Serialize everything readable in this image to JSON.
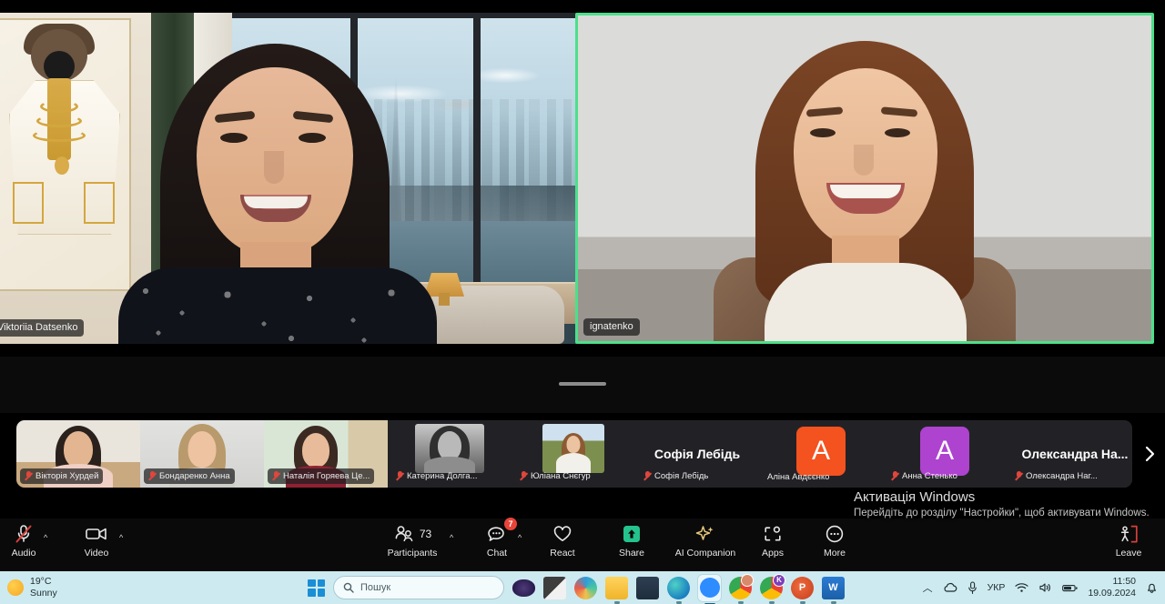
{
  "meeting": {
    "speakers": [
      {
        "name": "Viktoriia Datsenko",
        "active": false
      },
      {
        "name": "ignatenko",
        "active": true
      }
    ],
    "active_border_color": "#4ce08a"
  },
  "filmstrip": {
    "next_icon": "chevron-right-icon",
    "thumbs": [
      {
        "name": "Вікторія Хурдей",
        "kind": "video",
        "muted": true
      },
      {
        "name": "Бондаренко Анна",
        "kind": "video",
        "muted": true
      },
      {
        "name": "Наталія Горяева Це...",
        "kind": "video",
        "muted": true
      },
      {
        "name": "Катерина Долга...",
        "kind": "photo",
        "muted": true
      },
      {
        "name": "Юліана Снєгур",
        "kind": "photo",
        "muted": true
      },
      {
        "name": "Софія Лебідь",
        "kind": "name",
        "display": "Софія Лебідь",
        "muted": true
      },
      {
        "name": "Аліна Авдєєнко",
        "kind": "avatar",
        "letter": "A",
        "color": "#f4521f",
        "muted": false
      },
      {
        "name": "Анна Стенько",
        "kind": "avatar",
        "letter": "A",
        "color": "#ad43cf",
        "muted": true
      },
      {
        "name": "Олександра Наг...",
        "kind": "name",
        "display": "Олександра  На...",
        "muted": true
      }
    ]
  },
  "toolbar": {
    "audio": {
      "label": "Audio",
      "icon": "microphone-muted-icon",
      "muted": true
    },
    "video": {
      "label": "Video",
      "icon": "camera-icon"
    },
    "participants": {
      "label": "Participants",
      "icon": "people-icon",
      "count": "73"
    },
    "chat": {
      "label": "Chat",
      "icon": "chat-bubble-icon",
      "badge": "7"
    },
    "react": {
      "label": "React",
      "icon": "heart-icon"
    },
    "share": {
      "label": "Share",
      "icon": "share-screen-icon"
    },
    "ai_companion": {
      "label": "AI Companion",
      "icon": "sparkle-icon"
    },
    "apps": {
      "label": "Apps",
      "icon": "apps-icon"
    },
    "more": {
      "label": "More",
      "icon": "ellipsis-icon"
    },
    "leave": {
      "label": "Leave",
      "icon": "leave-door-icon"
    }
  },
  "watermark": {
    "title": "Активація Windows",
    "subtitle": "Перейдіть до розділу \"Настройки\", щоб активувати Windows."
  },
  "taskbar": {
    "weather": {
      "temp": "19°C",
      "condition": "Sunny",
      "icon": "sun-icon"
    },
    "start_icon": "windows-logo-icon",
    "search": {
      "placeholder": "Пошук",
      "icon": "search-icon"
    },
    "apps": [
      {
        "name": "copilot-icon"
      },
      {
        "name": "task-view-icon"
      },
      {
        "name": "windows-copilot-icon"
      },
      {
        "name": "file-explorer-icon"
      },
      {
        "name": "microsoft-store-icon"
      },
      {
        "name": "microsoft-edge-icon"
      },
      {
        "name": "zoom-icon"
      },
      {
        "name": "google-chrome-icon"
      },
      {
        "name": "google-chrome-k-icon"
      },
      {
        "name": "powerpoint-icon"
      },
      {
        "name": "word-icon"
      }
    ],
    "tray": {
      "chevron": "chevron-up-icon",
      "onedrive": "cloud-icon",
      "mic": "microphone-icon",
      "language": "УКР",
      "wifi": "wifi-icon",
      "volume": "speaker-icon",
      "battery": "battery-icon",
      "time": "11:50",
      "date": "19.09.2024",
      "notifications": "bell-icon"
    }
  }
}
